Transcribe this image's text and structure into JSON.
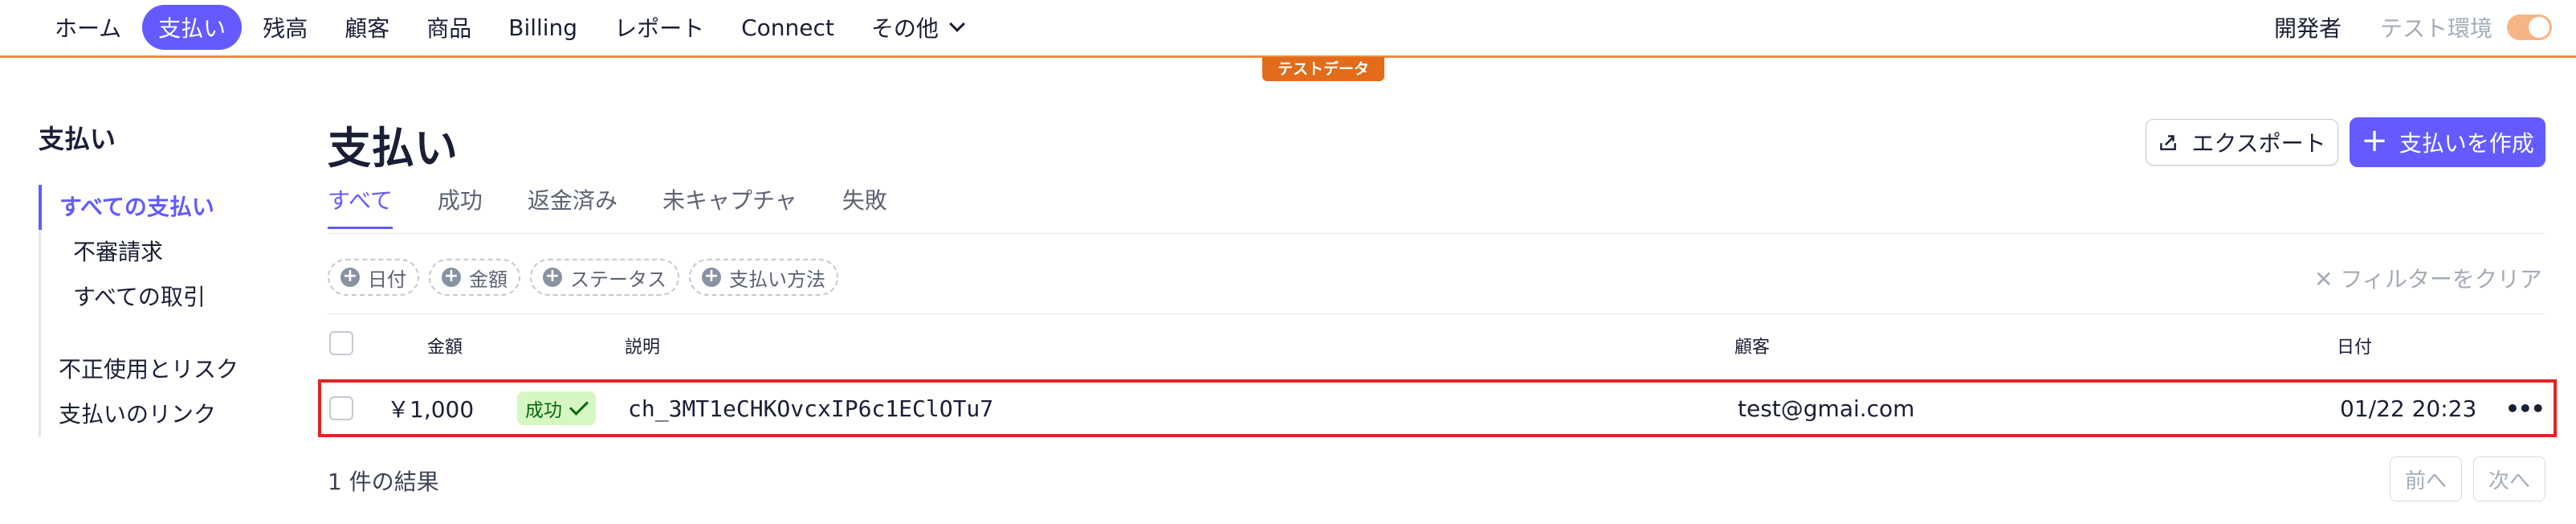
{
  "nav": {
    "items": [
      {
        "label": "ホーム",
        "active": false
      },
      {
        "label": "支払い",
        "active": true
      },
      {
        "label": "残高",
        "active": false
      },
      {
        "label": "顧客",
        "active": false
      },
      {
        "label": "商品",
        "active": false
      },
      {
        "label": "Billing",
        "active": false
      },
      {
        "label": "レポート",
        "active": false
      },
      {
        "label": "Connect",
        "active": false
      }
    ],
    "more_label": "その他",
    "developer_label": "開発者",
    "test_mode_label": "テスト環境",
    "test_mode_on": true
  },
  "test_badge": "テストデータ",
  "sidebar": {
    "title": "支払い",
    "items": [
      {
        "label": "すべての支払い"
      },
      {
        "label": "不審請求"
      },
      {
        "label": "すべての取引"
      },
      {
        "label": "不正使用とリスク"
      },
      {
        "label": "支払いのリンク"
      }
    ]
  },
  "page": {
    "title": "支払い",
    "export_label": "エクスポート",
    "create_label": "支払いを作成"
  },
  "tabs": [
    "すべて",
    "成功",
    "返金済み",
    "未キャプチャ",
    "失敗"
  ],
  "filters": {
    "chips": [
      "日付",
      "金額",
      "ステータス",
      "支払い方法"
    ],
    "clear_label": "フィルターをクリア"
  },
  "table": {
    "headers": {
      "amount": "金額",
      "description": "説明",
      "customer": "顧客",
      "date": "日付"
    },
    "rows": [
      {
        "amount": "￥1,000",
        "status": "成功",
        "description": "ch_3MT1eCHKOvcxIP6c1EClOTu7",
        "customer": "test@gmai.com",
        "date": "01/22 20:23"
      }
    ]
  },
  "footer": {
    "result_count": "1 件の結果",
    "prev_label": "前へ",
    "next_label": "次へ"
  },
  "colors": {
    "accent": "#635bff",
    "test_mode": "#e26c1a",
    "success_bg": "#d7f7c2",
    "success_text": "#05690d",
    "highlight": "#e02424"
  }
}
